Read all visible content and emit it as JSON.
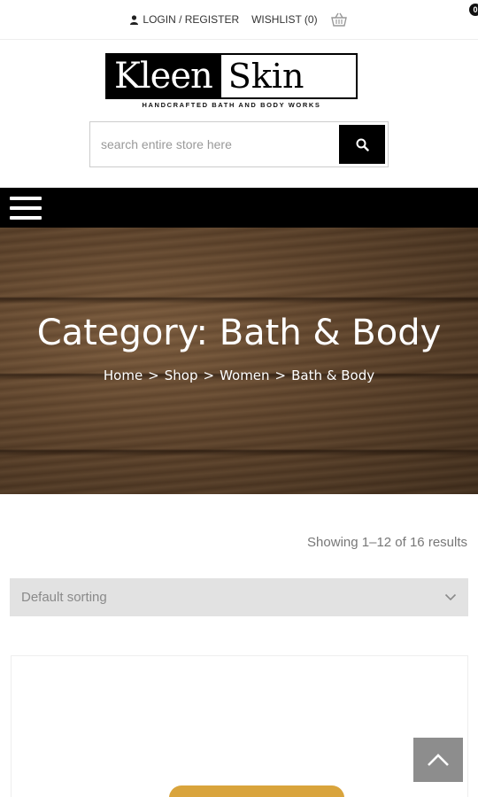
{
  "topbar": {
    "login_label": "LOGIN / REGISTER",
    "wishlist_label": "WISHLIST (0)",
    "cart_count": "0"
  },
  "logo": {
    "left_text": "Kleen",
    "right_text": "Skin",
    "tagline": "HANDCRAFTED BATH AND BODY WORKS"
  },
  "search": {
    "placeholder": "search entire store here"
  },
  "hero": {
    "title": "Category: Bath & Body",
    "breadcrumb": [
      "Home",
      "Shop",
      "Women",
      "Bath & Body"
    ],
    "separator": ">"
  },
  "catalog": {
    "results_text": "Showing 1–12 of 16 results",
    "sort_selected": "Default sorting"
  },
  "colors": {
    "nav_bg": "#000000",
    "sort_bg": "#e2e2e2",
    "back_to_top_bg": "#8d8d8d"
  }
}
